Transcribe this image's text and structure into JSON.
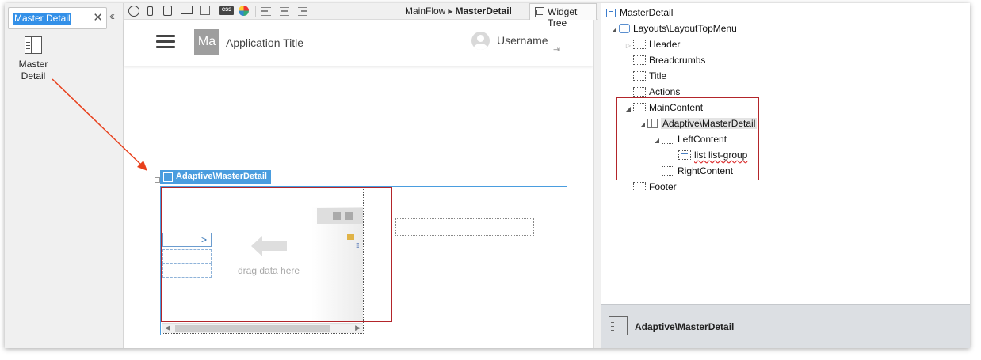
{
  "toolbox": {
    "search_value": "Master Detail",
    "clear_icon": "close-icon",
    "collapse_icon": "double-chevron-left-icon",
    "widget_label_line1": "Master",
    "widget_label_line2": "Detail"
  },
  "toolbar": {
    "icons": [
      "globe-icon",
      "phone-icon",
      "tablet-icon",
      "desktop-icon",
      "rotate-icon",
      "css-icon",
      "theme-icon",
      "align-left-icon",
      "align-center-icon",
      "align-right-icon"
    ],
    "css_label": "CSS"
  },
  "breadcrumb": {
    "flow": "MainFlow",
    "screen": "MasterDetail"
  },
  "widget_tree_tab": "Widget Tree",
  "canvas": {
    "logo_text": "Ma",
    "app_title": "Application Title",
    "username": "Username",
    "widget_tag": "Adaptive\\MasterDetail",
    "drag_text": "drag data here",
    "list_chevron": ">"
  },
  "tree": {
    "root": "MasterDetail",
    "layout": "Layouts\\LayoutTopMenu",
    "header": "Header",
    "breadcrumbs": "Breadcrumbs",
    "title": "Title",
    "actions": "Actions",
    "main_content": "MainContent",
    "adaptive": "Adaptive\\MasterDetail",
    "left_content": "LeftContent",
    "list_group": "list list-group",
    "right_content": "RightContent",
    "footer": "Footer"
  },
  "properties": {
    "title": "Adaptive\\MasterDetail"
  },
  "colors": {
    "highlight_red": "#b3252a",
    "accent_blue": "#4a9ddf",
    "selection_blue": "#3390e8"
  }
}
